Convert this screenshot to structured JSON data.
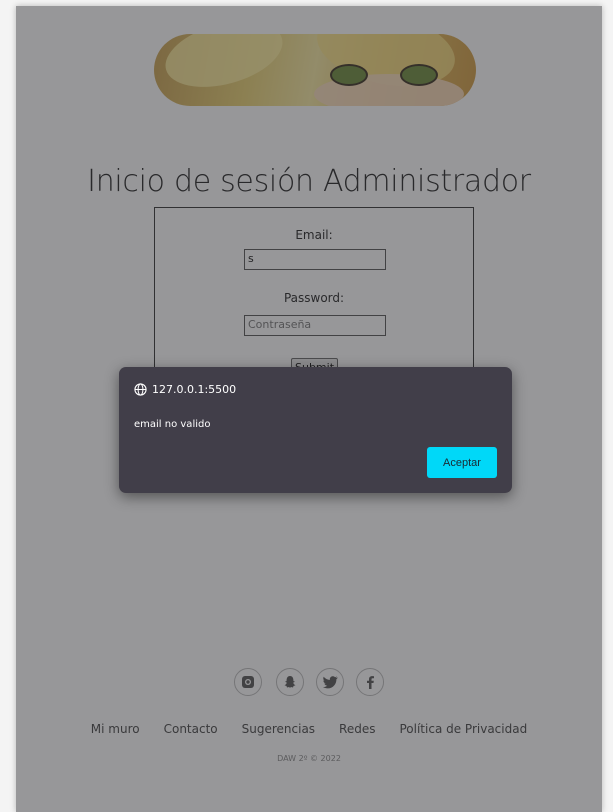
{
  "page": {
    "heading": "Inicio de sesión Administrador",
    "banner_alt": "anime banner"
  },
  "form": {
    "email_label": "Email:",
    "email_value": "s",
    "password_label": "Password:",
    "password_placeholder": "Contraseña",
    "submit_label": "Submit"
  },
  "footer": {
    "social_icons": [
      "instagram-icon",
      "snapchat-icon",
      "twitter-icon",
      "facebook-icon"
    ],
    "links": [
      "Mi muro",
      "Contacto",
      "Sugerencias",
      "Redes",
      "Política de Privacidad"
    ],
    "copyright": "DAW 2º © 2022"
  },
  "dialog": {
    "origin": "127.0.0.1:5500",
    "message": "email no valido",
    "button_label": "Aceptar",
    "accent_color": "#00d8f8"
  }
}
